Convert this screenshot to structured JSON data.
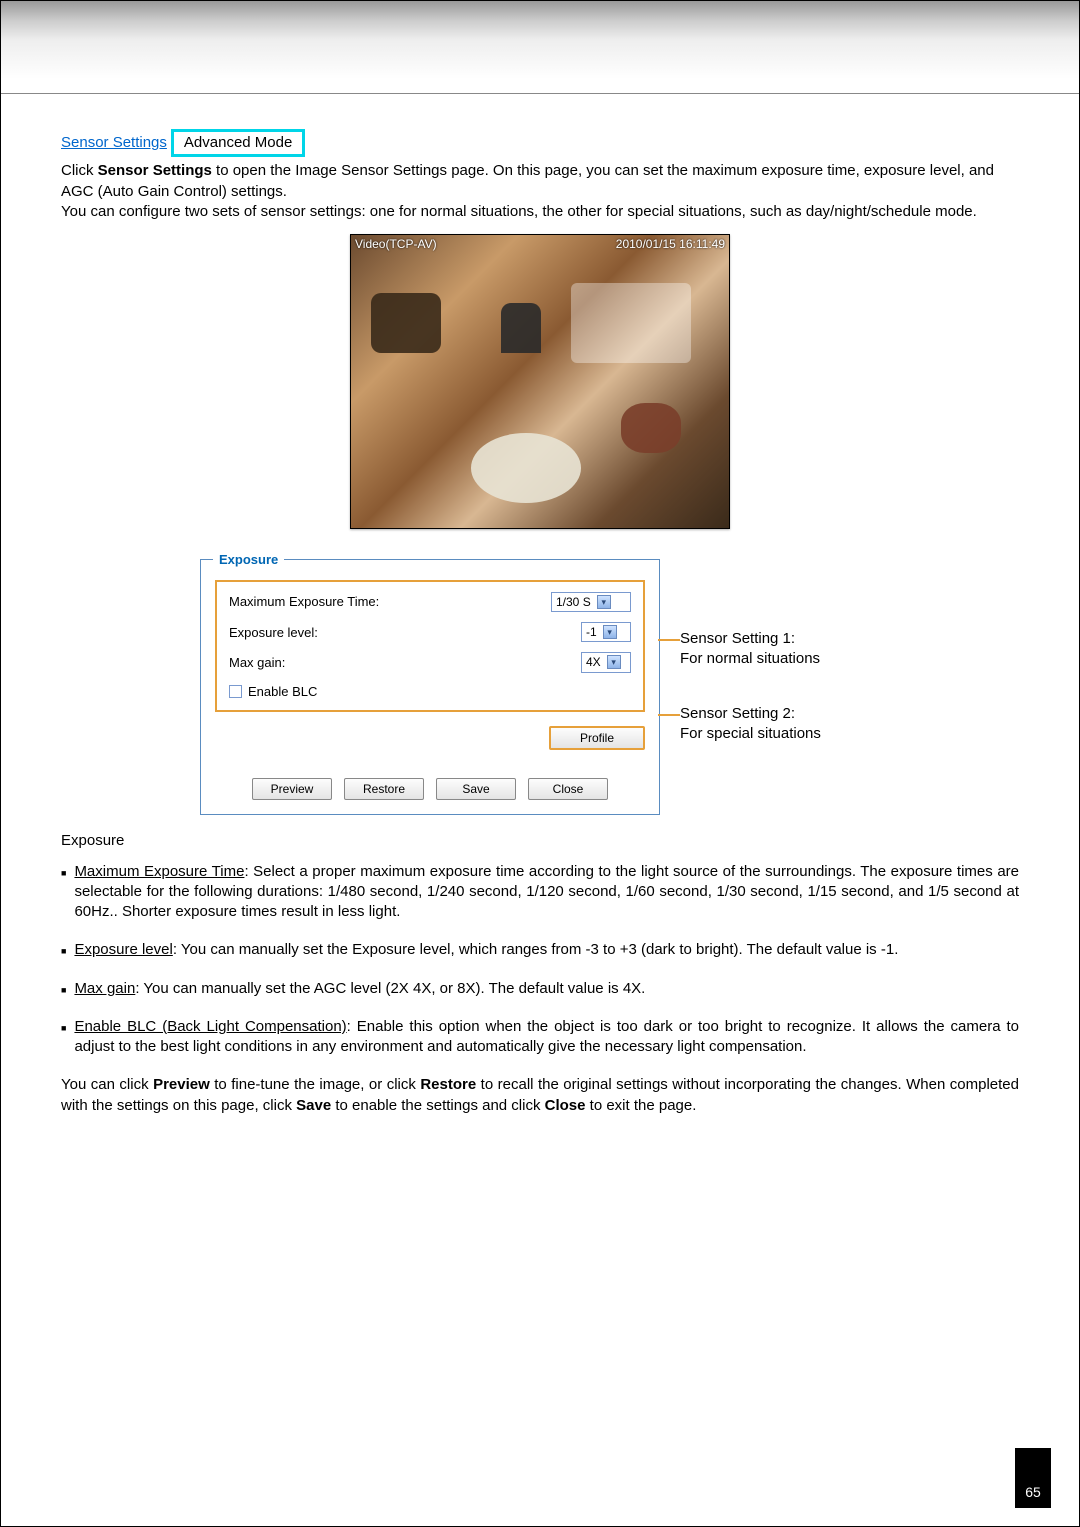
{
  "heading": {
    "link": "Sensor Settings",
    "badge": "Advanced Mode"
  },
  "intro": {
    "line1_pre": "Click ",
    "line1_bold": "Sensor Settings",
    "line1_post": " to open the Image Sensor Settings page. On this page, you can set the maximum exposure time, exposure level, and AGC (Auto Gain Control) settings.",
    "line2": "You can configure two sets of sensor settings: one for normal situations, the other for special situations, such as day/night/schedule mode."
  },
  "video": {
    "left_label": "Video(TCP-AV)",
    "right_label": "2010/01/15 16:11:49"
  },
  "panel": {
    "legend": "Exposure",
    "row_max_exp": "Maximum Exposure Time:",
    "val_max_exp": "1/30 S",
    "row_exp_level": "Exposure level:",
    "val_exp_level": "-1",
    "row_max_gain": "Max gain:",
    "val_max_gain": "4X",
    "row_enable_blc": "Enable BLC",
    "btn_profile": "Profile",
    "btn_preview": "Preview",
    "btn_restore": "Restore",
    "btn_save": "Save",
    "btn_close": "Close"
  },
  "annot": {
    "s1_title": "Sensor Setting 1:",
    "s1_body": "For normal situations",
    "s2_title": "Sensor Setting 2:",
    "s2_body": "For special situations"
  },
  "section_label": "Exposure",
  "bullets": {
    "b1_u": "Maximum Exposure Time",
    "b1_t": ": Select a proper maximum exposure time according to the light source of the surroundings. The exposure times are selectable for the following durations: 1/480 second, 1/240 second, 1/120 second, 1/60 second, 1/30 second, 1/15 second, and 1/5 second at 60Hz.. Shorter exposure times result in less light.",
    "b2_u": "Exposure level",
    "b2_t": ": You can manually set the Exposure level, which ranges from -3 to +3 (dark to bright). The default value is -1.",
    "b3_u": "Max gain",
    "b3_t": ": You can manually set the AGC level (2X 4X, or 8X). The default value is 4X.",
    "b4_u": "Enable BLC (Back Light Compensation)",
    "b4_t": ": Enable this option when the object is too dark or too bright to recognize. It allows the camera to adjust to the best light conditions in any environment and automatically give the necessary light compensation."
  },
  "closing_html": "You can click <b>Preview</b> to fine-tune the image, or click <b>Restore</b> to recall the original settings without incorporating the changes. When completed with the settings on this page, click <b>Save</b> to enable the settings and click <b>Close</b> to exit the page.",
  "page_number": "65"
}
